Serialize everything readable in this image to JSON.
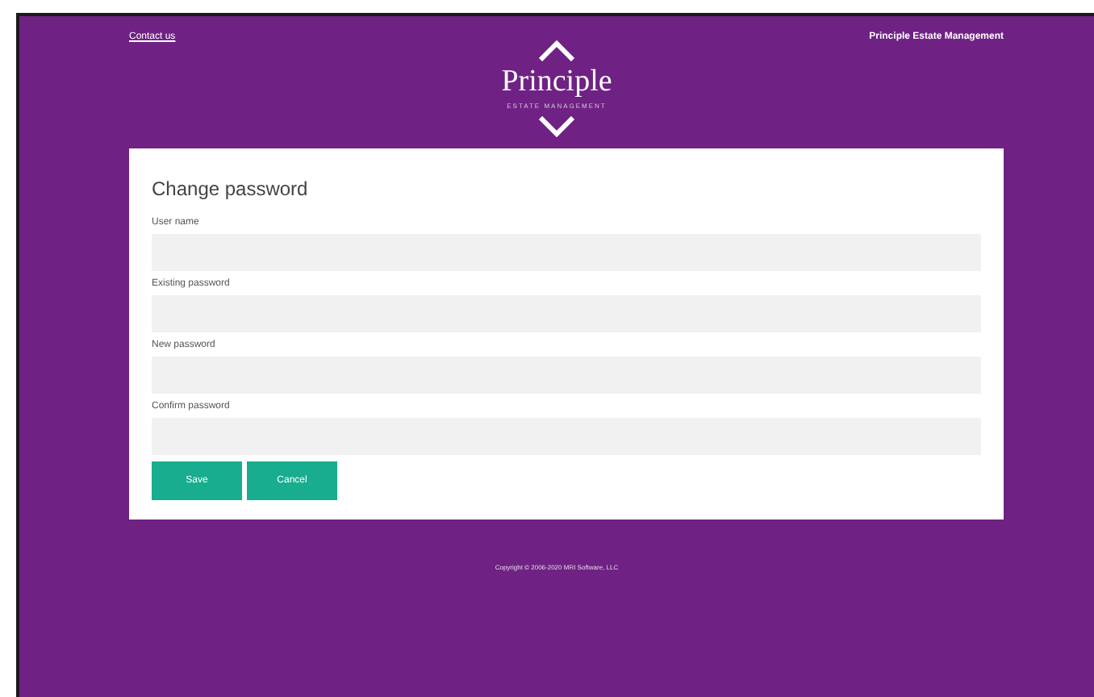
{
  "header": {
    "contact_link": "Contact us",
    "company": "Principle Estate Management",
    "logo": {
      "name": "Principle",
      "tagline": "ESTATE MANAGEMENT"
    }
  },
  "form": {
    "title": "Change password",
    "fields": [
      {
        "label": "User name"
      },
      {
        "label": "Existing password"
      },
      {
        "label": "New password"
      },
      {
        "label": "Confirm password"
      }
    ],
    "buttons": [
      "Save",
      "Cancel"
    ]
  },
  "footer": "Copyright © 2006-2020 MRI Software, LLC"
}
